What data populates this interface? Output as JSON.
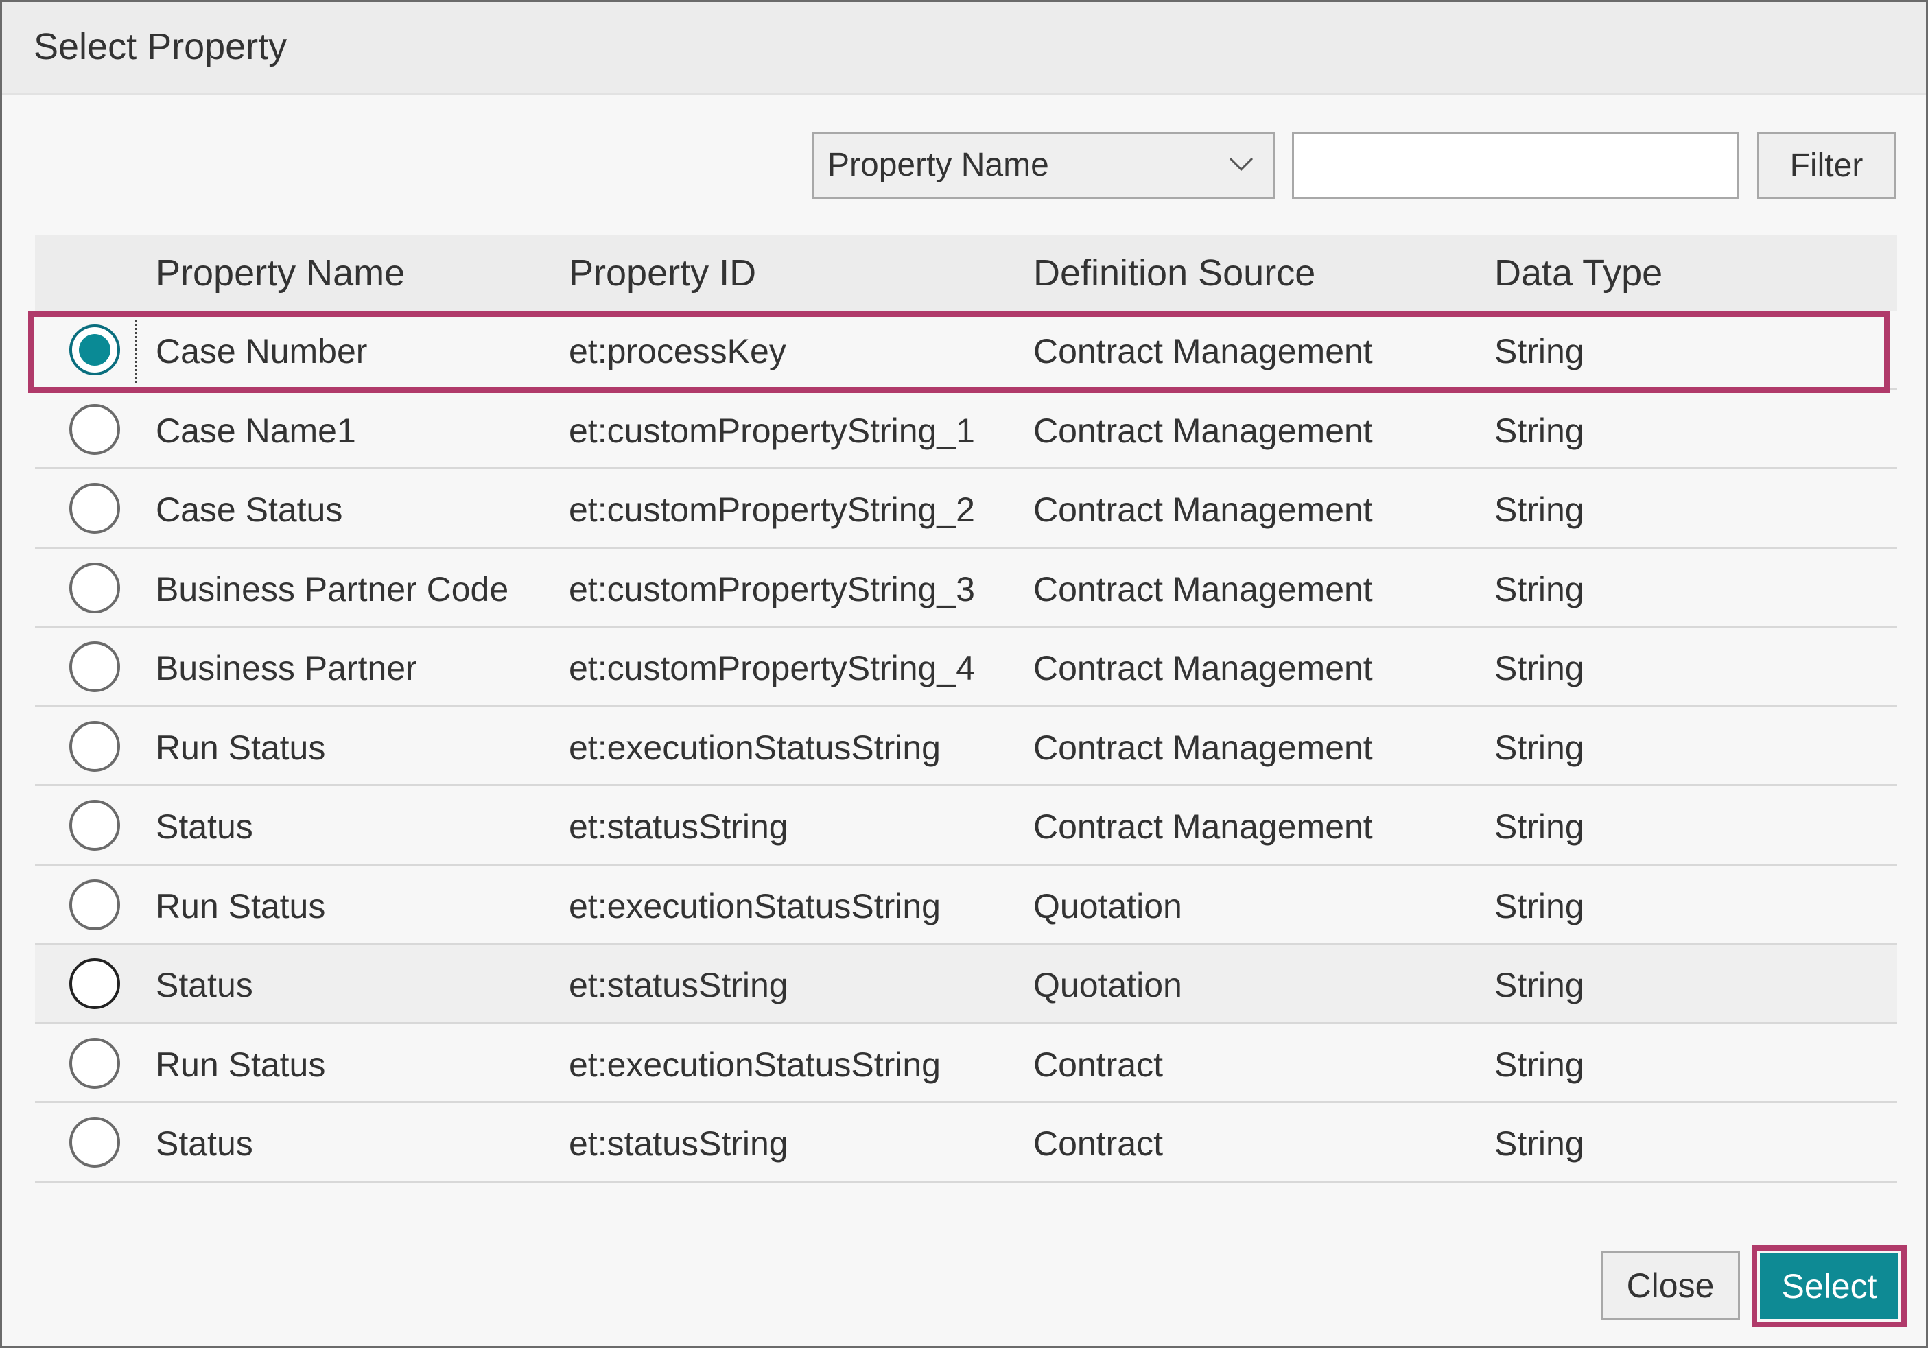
{
  "dialog": {
    "title": "Select Property"
  },
  "filter": {
    "field_selected": "Property Name",
    "search_value": "",
    "button_label": "Filter"
  },
  "table": {
    "columns": [
      "Property Name",
      "Property ID",
      "Definition Source",
      "Data Type"
    ],
    "rows": [
      {
        "selected": true,
        "name": "Case Number",
        "id": "et:processKey",
        "source": "Contract Management",
        "type": "String"
      },
      {
        "selected": false,
        "name": "Case Name1",
        "id": "et:customPropertyString_1",
        "source": "Contract Management",
        "type": "String"
      },
      {
        "selected": false,
        "name": "Case Status",
        "id": "et:customPropertyString_2",
        "source": "Contract Management",
        "type": "String"
      },
      {
        "selected": false,
        "name": "Business Partner Code",
        "id": "et:customPropertyString_3",
        "source": "Contract Management",
        "type": "String"
      },
      {
        "selected": false,
        "name": "Business Partner",
        "id": "et:customPropertyString_4",
        "source": "Contract Management",
        "type": "String"
      },
      {
        "selected": false,
        "name": "Run Status",
        "id": "et:executionStatusString",
        "source": "Contract Management",
        "type": "String"
      },
      {
        "selected": false,
        "name": "Status",
        "id": "et:statusString",
        "source": "Contract Management",
        "type": "String"
      },
      {
        "selected": false,
        "name": "Run Status",
        "id": "et:executionStatusString",
        "source": "Quotation",
        "type": "String"
      },
      {
        "selected": false,
        "name": "Status",
        "id": "et:statusString",
        "source": "Quotation",
        "type": "String"
      },
      {
        "selected": false,
        "name": "Run Status",
        "id": "et:executionStatusString",
        "source": "Contract",
        "type": "String"
      },
      {
        "selected": false,
        "name": "Status",
        "id": "et:statusString",
        "source": "Contract",
        "type": "String"
      }
    ]
  },
  "footer": {
    "close_label": "Close",
    "select_label": "Select"
  },
  "colors": {
    "accent": "#0e8a94",
    "highlight": "#b03a6a"
  },
  "icons": {
    "dropdown": "chevron-down-icon"
  }
}
